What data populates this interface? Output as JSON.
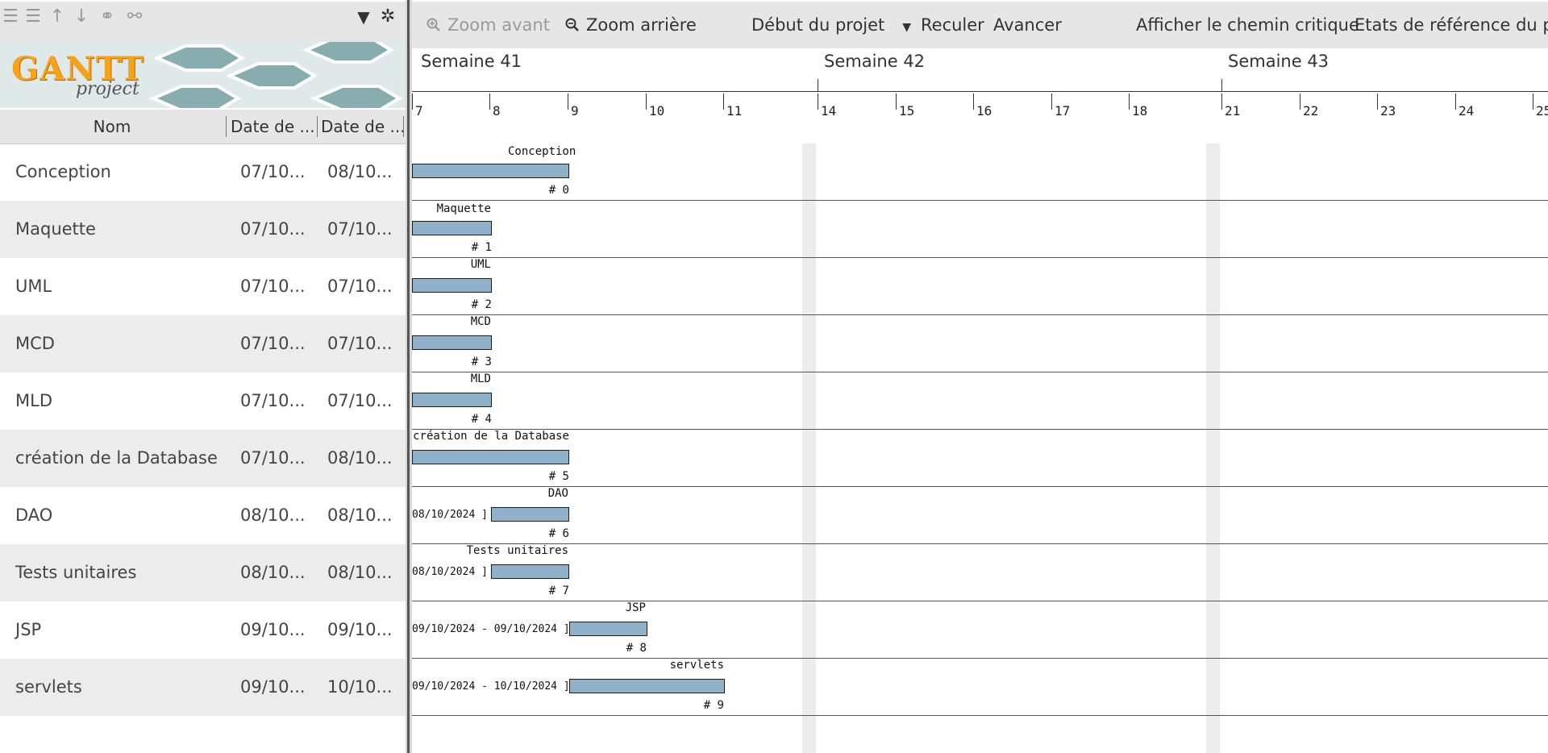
{
  "left_toolbar": {
    "icons": [
      "outdent-icon",
      "indent-icon",
      "move-up-icon",
      "move-down-icon",
      "link-icon",
      "unlink-icon"
    ],
    "filter_icon": "filter-icon",
    "settings_icon": "gear-icon"
  },
  "logo": {
    "text": "GANTT",
    "sub": "project"
  },
  "columns": [
    {
      "label": "Nom"
    },
    {
      "label": "Date de ..."
    },
    {
      "label": "Date de ..."
    }
  ],
  "tasks": [
    {
      "name": "Conception",
      "start": "07/10...",
      "end": "08/10...",
      "id": "# 0"
    },
    {
      "name": "Maquette",
      "start": "07/10...",
      "end": "07/10...",
      "id": "# 1"
    },
    {
      "name": "UML",
      "start": "07/10...",
      "end": "07/10...",
      "id": "# 2"
    },
    {
      "name": "MCD",
      "start": "07/10...",
      "end": "07/10...",
      "id": "# 3"
    },
    {
      "name": "MLD",
      "start": "07/10...",
      "end": "07/10...",
      "id": "# 4"
    },
    {
      "name": "création de la Database",
      "start": "07/10...",
      "end": "08/10...",
      "id": "# 5"
    },
    {
      "name": "DAO",
      "start": "08/10...",
      "end": "08/10...",
      "id": "# 6",
      "date_label": "08/10/2024 ]"
    },
    {
      "name": "Tests unitaires",
      "start": "08/10...",
      "end": "08/10...",
      "id": "# 7",
      "date_label": "08/10/2024 ]"
    },
    {
      "name": "JSP",
      "start": "09/10...",
      "end": "09/10...",
      "id": "# 8",
      "date_label": "09/10/2024 - 09/10/2024 ]"
    },
    {
      "name": "servlets",
      "start": "09/10...",
      "end": "10/10...",
      "id": "# 9",
      "date_label": "09/10/2024 - 10/10/2024 ]"
    }
  ],
  "right_toolbar": {
    "zoom_in": "Zoom avant",
    "zoom_out": "Zoom arrière",
    "project_start": "Début du projet",
    "back": "Reculer",
    "forward": "Avancer",
    "critical_path": "Afficher le chemin critique",
    "baselines": "Etats de référence du pro"
  },
  "timeline": {
    "weeks": [
      "Semaine 41",
      "Semaine 42",
      "Semaine 43"
    ],
    "days": [
      "7",
      "8",
      "9",
      "10",
      "11",
      "14",
      "15",
      "16",
      "17",
      "18",
      "21",
      "22",
      "23",
      "24",
      "25"
    ]
  },
  "colors": {
    "bar": "#8fb1c9",
    "accent": "#f6a31b"
  }
}
